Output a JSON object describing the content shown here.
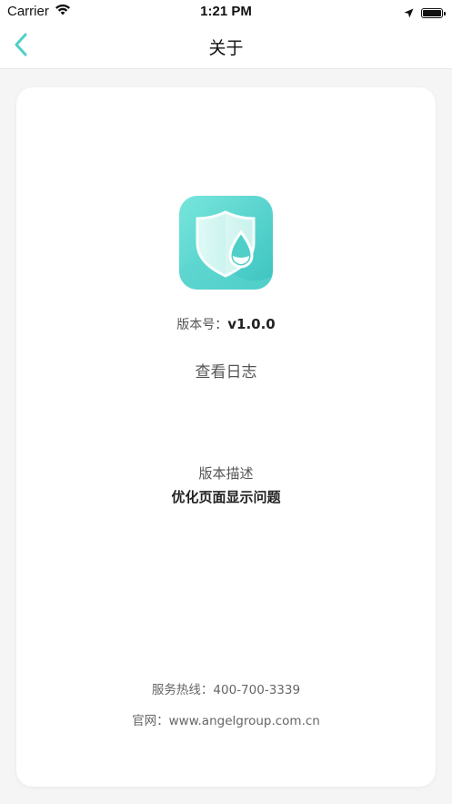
{
  "status_bar": {
    "carrier": "Carrier",
    "time": "1:21 PM",
    "icons": [
      "wifi-icon",
      "location-arrow-icon",
      "battery-icon"
    ]
  },
  "nav": {
    "title": "关于",
    "back_icon": "chevron-left-icon"
  },
  "about": {
    "app_icon": "shield-water-drop-icon",
    "version_label": "版本号：",
    "version_value": "v1.0.0",
    "view_log_label": "查看日志",
    "description_label": "版本描述",
    "description_value": "优化页面显示问题",
    "hotline": "服务热线：400-700-3339",
    "website": "官网：www.angelgroup.com.cn"
  },
  "colors": {
    "accent": "#4fcfc8",
    "background": "#f5f5f5",
    "card": "#ffffff",
    "icon_gradient_start": "#6fe3d9",
    "icon_gradient_end": "#3cc4c2"
  }
}
